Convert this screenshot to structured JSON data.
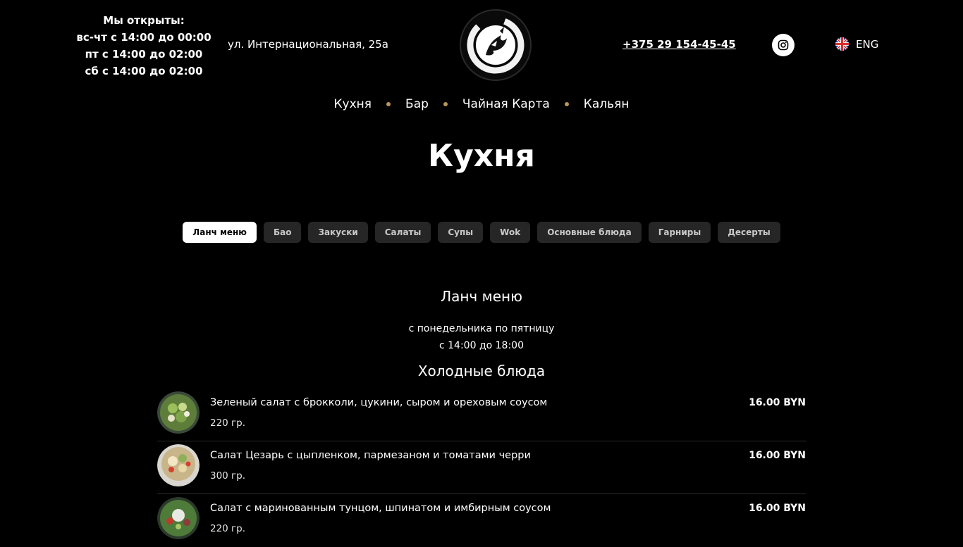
{
  "header": {
    "hours": [
      "Мы открыты:",
      "вс-чт с 14:00 до 00:00",
      "пт с 14:00 до 02:00",
      "сб с 14:00 до 02:00"
    ],
    "address": "ул. Интернациональная, 25а",
    "phone": "+375 29 154-45-45",
    "language": "ENG",
    "instagram_icon": "instagram-icon",
    "flag_icon": "uk-flag-icon"
  },
  "nav": {
    "items": [
      "Кухня",
      "Бар",
      "Чайная Карта",
      "Кальян"
    ]
  },
  "page_title": "Кухня",
  "tabs": [
    "Ланч меню",
    "Бао",
    "Закуски",
    "Салаты",
    "Супы",
    "Wok",
    "Основные блюда",
    "Гарниры",
    "Десерты"
  ],
  "active_tab": "Ланч меню",
  "section": {
    "title": "Ланч меню",
    "subtitle_line1": "с понедельника по пятницу",
    "subtitle_line2": "с 14:00 до 18:00",
    "group_title": "Холодные блюда"
  },
  "menu_items": [
    {
      "name": "Зеленый салат с брокколи, цукини, сыром и ореховым соусом",
      "weight": "220 гр.",
      "price": "16.00 BYN"
    },
    {
      "name": "Салат Цезарь с цыпленком, пармезаном и томатами черри",
      "weight": "300 гр.",
      "price": "16.00 BYN"
    },
    {
      "name": "Салат с маринованным тунцом, шпинатом и имбирным соусом",
      "weight": "220 гр.",
      "price": "16.00 BYN"
    }
  ],
  "colors": {
    "background": "#000000",
    "accent_dot": "#b9965a",
    "tab_bg": "#262626",
    "tab_active_bg": "#ffffff"
  }
}
